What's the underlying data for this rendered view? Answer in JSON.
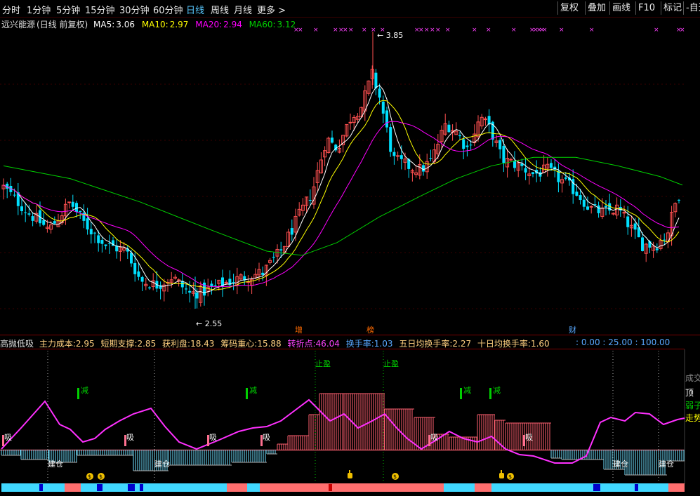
{
  "toolbar": {
    "periods": [
      "分时",
      "1分钟",
      "5分钟",
      "15分钟",
      "30分钟",
      "60分钟",
      "日线",
      "周线",
      "月线",
      "更多 >"
    ],
    "active_period": "日线",
    "right_buttons": [
      "复权",
      "叠加",
      "画线",
      "F10",
      "标记",
      "-自选"
    ]
  },
  "stock": {
    "name": "远兴能源",
    "mode": "(日线 前复权)"
  },
  "ma": {
    "ma5": {
      "label": "MA5:",
      "value": "3.06",
      "color": "#ffffff"
    },
    "ma10": {
      "label": "MA10:",
      "value": "2.97",
      "color": "#ffff00"
    },
    "ma20": {
      "label": "MA20:",
      "value": "2.94",
      "color": "#ff00ff"
    },
    "ma60": {
      "label": "MA60:",
      "value": "3.12",
      "color": "#00d000"
    }
  },
  "price_marks": {
    "high": "3.85",
    "low": "2.55"
  },
  "event_marks": [
    "增",
    "榜",
    "财"
  ],
  "indicator": {
    "name": "高抛低吸",
    "fields": [
      {
        "label": "主力成本:",
        "value": "2.95",
        "color": "#ffd080"
      },
      {
        "label": "短期支撑:",
        "value": "2.85",
        "color": "#ffd080"
      },
      {
        "label": "获利盘:",
        "value": "18.43",
        "color": "#ffd080"
      },
      {
        "label": "筹码重心:",
        "value": "15.88",
        "color": "#ffd080"
      },
      {
        "label": "转折点:",
        "value": "46.04",
        "color": "#ff44ff"
      },
      {
        "label": "换手率:",
        "value": "1.03",
        "color": "#58a8ff"
      },
      {
        "label": "五日均换手率:",
        "value": "2.27",
        "color": "#ffd080"
      },
      {
        "label": "十日均换手率:",
        "value": "1.60",
        "color": "#ffd080"
      }
    ],
    "scale": [
      ": 0.00",
      ": 25.00",
      ": 100.00"
    ],
    "labels": {
      "stop_profit": "止盈",
      "reduce": "减",
      "absorb": "吸",
      "build": "建仓"
    }
  },
  "right_labels": [
    "成交",
    "顶",
    "弱子",
    "走势"
  ],
  "colors": {
    "up": "#ff5050",
    "down": "#00e0ff",
    "bg": "#000000",
    "grid": "#7a0000",
    "ma5": "#ffffff",
    "ma10": "#ffff00",
    "ma20": "#ff00ff",
    "ma60": "#00d000"
  }
}
